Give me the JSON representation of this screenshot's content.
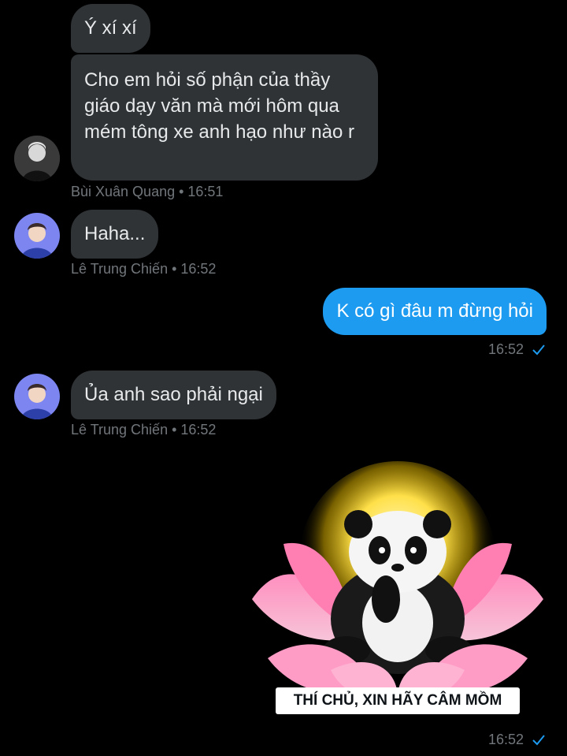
{
  "messages": [
    {
      "text": "Ý xí xí"
    },
    {
      "text": "Cho em hỏi số phận của thầy giáo dạy văn mà mới hôm qua mém tông xe anh hạo như nào r"
    },
    {
      "meta": "Bùi Xuân Quang • 16:51"
    },
    {
      "text": "Haha..."
    },
    {
      "meta": "Lê Trung Chiến • 16:52"
    },
    {
      "text": "K có gì đâu m đừng hỏi",
      "time": "16:52"
    },
    {
      "text": "Ủa anh sao phải ngại"
    },
    {
      "meta": "Lê Trung Chiến • 16:52"
    }
  ],
  "sticker": {
    "caption": "THÍ CHỦ, XIN HÃY CÂM MỒM",
    "time": "16:52"
  },
  "colors": {
    "incoming_bubble": "#2f3336",
    "outgoing_bubble": "#1d9bf0",
    "meta_text": "#71767b",
    "read_check": "#1d9bf0"
  },
  "icons": {
    "read": "check-icon"
  }
}
